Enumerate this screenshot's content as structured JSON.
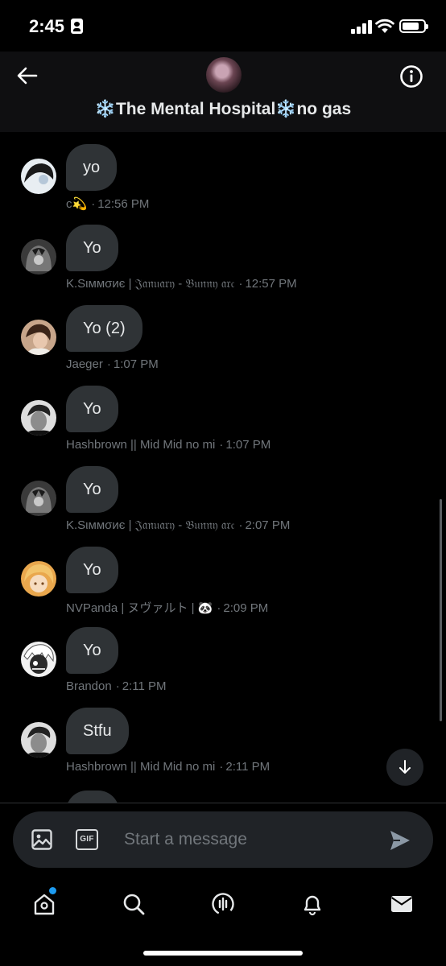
{
  "status_bar": {
    "time": "2:45"
  },
  "header": {
    "title_prefix": "❄️",
    "title_main": "The Mental Hospital",
    "title_mid": "❄️",
    "title_suffix": "no gas"
  },
  "messages": [
    {
      "text": "yo",
      "author": "c💫",
      "time": "12:56 PM",
      "avatar": "avatar-1"
    },
    {
      "text": "Yo",
      "author": "K.Sιммσиє | 𝔍𝔞𝔫𝔲𝔞𝔯𝔶 - 𝔅𝔲𝔫𝔫𝔶 𝔞𝔯𝔠",
      "time": "12:57 PM",
      "avatar": "avatar-2"
    },
    {
      "text": "Yo (2)",
      "author": "Jaeger",
      "time": "1:07 PM",
      "avatar": "avatar-3"
    },
    {
      "text": "Yo",
      "author": "Hashbrown || Mid Mid no mi",
      "time": "1:07 PM",
      "avatar": "avatar-4"
    },
    {
      "text": "Yo",
      "author": "K.Sιммσиє | 𝔍𝔞𝔫𝔲𝔞𝔯𝔶 - 𝔅𝔲𝔫𝔫𝔶 𝔞𝔯𝔠",
      "time": "2:07 PM",
      "avatar": "avatar-2"
    },
    {
      "text": "Yo",
      "author": "NVPanda | ヌヴァルト | 🐼",
      "time": "2:09 PM",
      "avatar": "avatar-5"
    },
    {
      "text": "Yo",
      "author": "Brandon",
      "time": "2:11 PM",
      "avatar": "avatar-6"
    },
    {
      "text": "Stfu",
      "author": "Hashbrown || Mid Mid no mi",
      "time": "2:11 PM",
      "avatar": "avatar-4"
    }
  ],
  "meta_separator": "·",
  "composer": {
    "gif_label": "GIF",
    "placeholder": "Start a message"
  },
  "colors": {
    "background": "#000000",
    "bubble": "#2f3336",
    "meta_text": "#71767b",
    "accent": "#1d9bf0"
  },
  "tabs": [
    "home-icon",
    "search-icon",
    "spaces-icon",
    "notifications-icon",
    "messages-icon"
  ]
}
